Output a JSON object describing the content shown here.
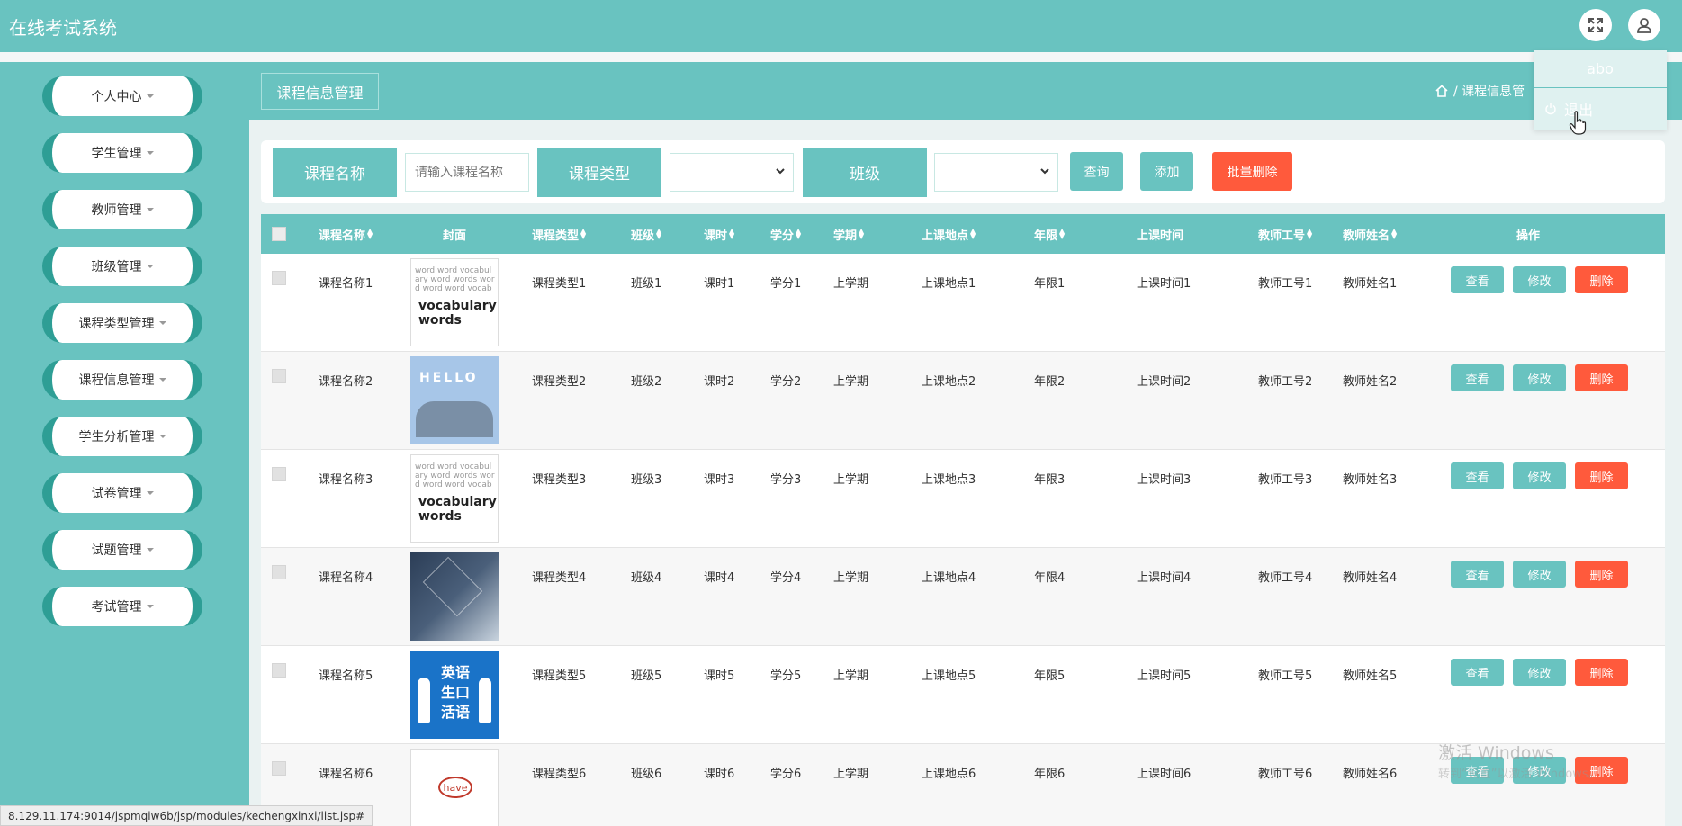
{
  "app": {
    "title": "在线考试系统"
  },
  "header_icons": {
    "fullscreen": "fullscreen-icon",
    "user": "user-icon"
  },
  "user_menu": {
    "username": "abo",
    "logout_label": "退出"
  },
  "sidebar": {
    "items": [
      {
        "label": "个人中心"
      },
      {
        "label": "学生管理"
      },
      {
        "label": "教师管理"
      },
      {
        "label": "班级管理"
      },
      {
        "label": "课程类型管理"
      },
      {
        "label": "课程信息管理"
      },
      {
        "label": "学生分析管理"
      },
      {
        "label": "试卷管理"
      },
      {
        "label": "试题管理"
      },
      {
        "label": "考试管理"
      }
    ]
  },
  "page": {
    "tab_title": "课程信息管理",
    "breadcrumb": "/ 课程信息管"
  },
  "search": {
    "name_label": "课程名称",
    "name_placeholder": "请输入课程名称",
    "type_label": "课程类型",
    "class_label": "班级",
    "query_button": "查询",
    "add_button": "添加",
    "batch_delete_button": "批量删除"
  },
  "table": {
    "columns": [
      "课程名称",
      "封面",
      "课程类型",
      "班级",
      "课时",
      "学分",
      "学期",
      "上课地点",
      "年限",
      "上课时间",
      "教师工号",
      "教师姓名",
      "操作"
    ],
    "rows": [
      {
        "name": "课程名称1",
        "cover": "vocabulary words",
        "type": "课程类型1",
        "class": "班级1",
        "hours": "课时1",
        "credit": "学分1",
        "term": "上学期",
        "place": "上课地点1",
        "years": "年限1",
        "time": "上课时间1",
        "teacher_no": "教师工号1",
        "teacher_name": "教师姓名1"
      },
      {
        "name": "课程名称2",
        "cover": "HELLO",
        "type": "课程类型2",
        "class": "班级2",
        "hours": "课时2",
        "credit": "学分2",
        "term": "上学期",
        "place": "上课地点2",
        "years": "年限2",
        "time": "上课时间2",
        "teacher_no": "教师工号2",
        "teacher_name": "教师姓名2"
      },
      {
        "name": "课程名称3",
        "cover": "vocabulary words",
        "type": "课程类型3",
        "class": "班级3",
        "hours": "课时3",
        "credit": "学分3",
        "term": "上学期",
        "place": "上课地点3",
        "years": "年限3",
        "time": "上课时间3",
        "teacher_no": "教师工号3",
        "teacher_name": "教师姓名3"
      },
      {
        "name": "课程名称4",
        "cover": "",
        "type": "课程类型4",
        "class": "班级4",
        "hours": "课时4",
        "credit": "学分4",
        "term": "上学期",
        "place": "上课地点4",
        "years": "年限4",
        "time": "上课时间4",
        "teacher_no": "教师工号4",
        "teacher_name": "教师姓名4"
      },
      {
        "name": "课程名称5",
        "cover": "英语 生口 活语",
        "type": "课程类型5",
        "class": "班级5",
        "hours": "课时5",
        "credit": "学分5",
        "term": "上学期",
        "place": "上课地点5",
        "years": "年限5",
        "time": "上课时间5",
        "teacher_no": "教师工号5",
        "teacher_name": "教师姓名5"
      },
      {
        "name": "课程名称6",
        "cover": "have",
        "type": "课程类型6",
        "class": "班级6",
        "hours": "课时6",
        "credit": "学分6",
        "term": "上学期",
        "place": "上课地点6",
        "years": "年限6",
        "time": "上课时间6",
        "teacher_no": "教师工号6",
        "teacher_name": "教师姓名6"
      }
    ],
    "actions": {
      "view": "查看",
      "edit": "修改",
      "delete": "删除"
    }
  },
  "status_url": "8.129.11.174:9014/jspmqiw6b/jsp/modules/kechengxinxi/list.jsp#",
  "watermark": {
    "line1": "激活 Windows",
    "line2": "转到“设置”以激活 Windows。"
  },
  "colors": {
    "primary": "#69c3c0",
    "accent_dark": "#2e9e95",
    "danger": "#ff5a3c",
    "background": "#eaf2f2"
  }
}
